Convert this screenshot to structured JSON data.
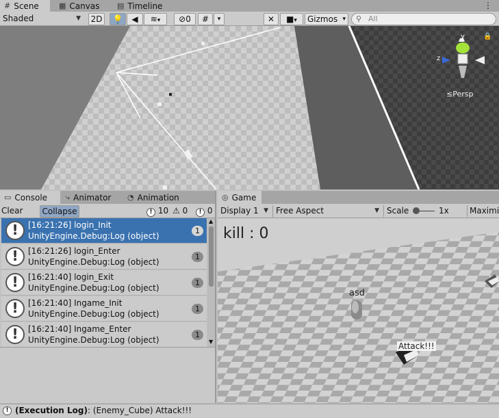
{
  "scene_tabs": [
    {
      "label": "Scene",
      "icon": "hash-icon",
      "active": true
    },
    {
      "label": "Canvas",
      "icon": "grid-icon",
      "active": false
    },
    {
      "label": "Timeline",
      "icon": "film-icon",
      "active": false
    }
  ],
  "scene_toolbar": {
    "shading_mode": "Shaded",
    "mode_2d": "2D",
    "hidden_count": "0",
    "gizmos_label": "Gizmos",
    "search_placeholder": "All"
  },
  "orientation_gizmo": {
    "y_label": "y",
    "z_label": "z",
    "projection_label": "Persp"
  },
  "bottom_left_tabs": [
    {
      "label": "Console",
      "icon": "console-icon",
      "active": true
    },
    {
      "label": "Animator",
      "icon": "animator-icon",
      "active": false
    },
    {
      "label": "Animation",
      "icon": "animation-icon",
      "active": false
    }
  ],
  "console_toolbar": {
    "clear_label": "Clear",
    "collapse_label": "Collapse",
    "info_count": "10",
    "warning_count": "0",
    "error_count": "0"
  },
  "console_logs": [
    {
      "message": "[16:21:26] login_Init",
      "source": "UnityEngine.Debug:Log (object)",
      "count": "1",
      "selected": true
    },
    {
      "message": "[16:21:26] login_Enter",
      "source": "UnityEngine.Debug:Log (object)",
      "count": "1",
      "selected": false
    },
    {
      "message": "[16:21:40] login_Exit",
      "source": "UnityEngine.Debug:Log (object)",
      "count": "1",
      "selected": false
    },
    {
      "message": "[16:21:40] Ingame_Init",
      "source": "UnityEngine.Debug:Log (object)",
      "count": "1",
      "selected": false
    },
    {
      "message": "[16:21:40] Ingame_Enter",
      "source": "UnityEngine.Debug:Log (object)",
      "count": "1",
      "selected": false
    }
  ],
  "game_tab": {
    "label": "Game",
    "icon": "gamepad-icon"
  },
  "game_toolbar": {
    "display_label": "Display 1",
    "aspect_label": "Free Aspect",
    "scale_label": "Scale",
    "scale_value": "1x",
    "maximize_label": "Maximiz"
  },
  "game_view": {
    "kill_text": "kill : 0",
    "player_name": "asd",
    "enemy_label": "Attack!!!"
  },
  "status_bar": {
    "prefix": "(Execution Log)",
    "message": ": (Enemy_Cube) Attack!!!"
  }
}
